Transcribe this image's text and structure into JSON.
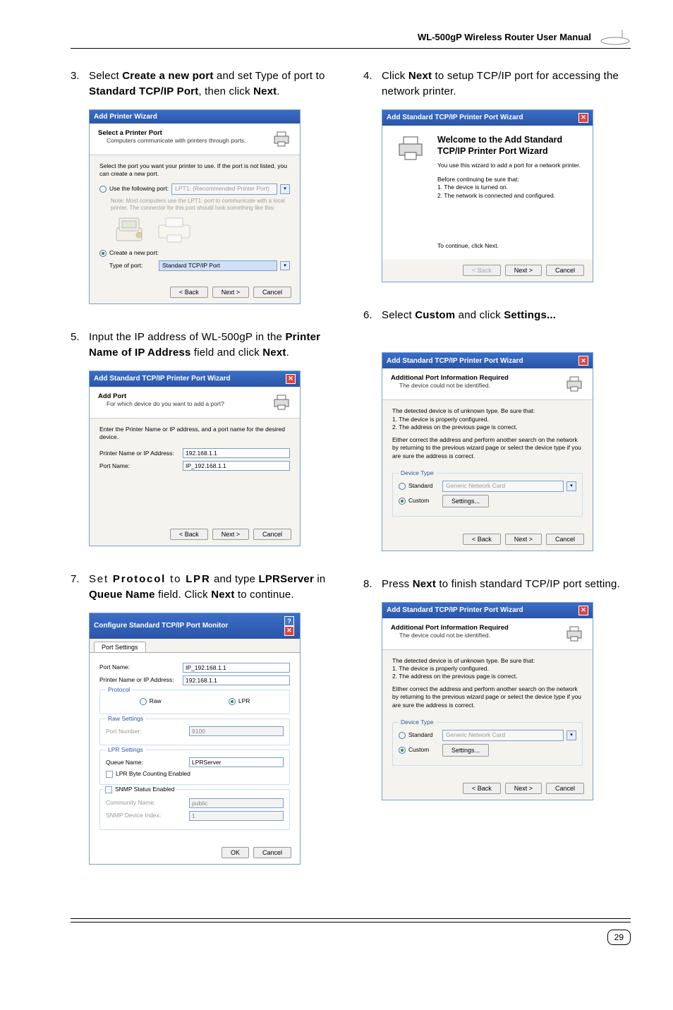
{
  "header": {
    "title": "WL-500gP Wireless Router User Manual"
  },
  "page_number": "29",
  "steps": {
    "s3": {
      "num": "3.",
      "text_pre": "Select ",
      "b1": "Create a new port",
      "text_mid": " and set Type of port to ",
      "b2": "Standard TCP/IP Port",
      "text_mid2": ", then click ",
      "b3": "Next",
      "text_post": "."
    },
    "s4": {
      "num": "4.",
      "text_pre": "Click ",
      "b1": "Next",
      "text_mid": " to setup TCP/IP port for accessing the network printer."
    },
    "s5": {
      "num": "5.",
      "text_pre": "Input the IP address of WL-500gP in the ",
      "b1": "Printer Name of IP Address",
      "text_mid": " field and click ",
      "b2": "Next",
      "text_post": "."
    },
    "s6": {
      "num": "6.",
      "text_pre": "Select ",
      "b1": "Custom",
      "text_mid": " and click ",
      "b2": "Settings...",
      "text_post": ""
    },
    "s7": {
      "num": "7.",
      "text_pre": "Set ",
      "b1": "Protocol",
      "text_mid": " to ",
      "b2": "LPR",
      "text_mid2": " and type ",
      "b3": "LPRServer",
      "text_mid3": " in ",
      "b4": "Queue Name",
      "text_mid4": " field. Click ",
      "b5": "Next",
      "text_post": " to continue."
    },
    "s8": {
      "num": "8.",
      "text_pre": "Press ",
      "b1": "Next",
      "text_mid": " to finish standard TCP/IP port setting."
    }
  },
  "common_btns": {
    "back": "< Back",
    "next": "Next >",
    "cancel": "Cancel",
    "ok": "OK"
  },
  "dlg3": {
    "title": "Add Printer Wizard",
    "head_title": "Select a Printer Port",
    "head_sub": "Computers communicate with printers through ports.",
    "desc": "Select the port you want your printer to use. If the port is not listed, you can create a new port.",
    "opt1": "Use the following port:",
    "opt1_val": "LPT1: (Recommended Printer Port)",
    "note": "Note: Most computers use the LPT1: port to communicate with a local printer. The connector for this port should look something like this:",
    "opt2": "Create a new port:",
    "opt2_label": "Type of port:",
    "opt2_val": "Standard TCP/IP Port"
  },
  "dlg4": {
    "title": "Add Standard TCP/IP Printer Port Wizard",
    "welcome_h": "Welcome to the Add Standard TCP/IP Printer Port Wizard",
    "welcome_p1": "You use this wizard to add a port for a network printer.",
    "welcome_p2": "Before continuing be sure that:",
    "welcome_li1": "1.  The device is turned on.",
    "welcome_li2": "2.  The network is connected and configured.",
    "welcome_cont": "To continue, click Next."
  },
  "dlg5": {
    "title": "Add Standard TCP/IP Printer Port Wizard",
    "head_title": "Add Port",
    "head_sub": "For which device do you want to add a port?",
    "desc": "Enter the Printer Name or IP address, and a port name for the desired device.",
    "lbl1": "Printer Name or IP Address:",
    "val1": "192.168.1.1",
    "lbl2": "Port Name:",
    "val2": "IP_192.168.1.1"
  },
  "dlg6": {
    "title": "Add Standard TCP/IP Printer Port Wizard",
    "head_title": "Additional Port Information Required",
    "head_sub": "The device could not be identified.",
    "p1": "The detected device is of unknown type. Be sure that:",
    "li1": "1. The device is properly configured.",
    "li2": "2. The address on the previous page is correct.",
    "p2": "Either correct the address and perform another search on the network by returning to the previous wizard page or select the device type if you are sure the address is correct.",
    "group": "Device Type",
    "opt_std": "Standard",
    "opt_std_val": "Generic Network Card",
    "opt_custom": "Custom",
    "btn_settings": "Settings..."
  },
  "dlg7": {
    "title": "Configure Standard TCP/IP Port Monitor",
    "tab": "Port Settings",
    "lbl_port": "Port Name:",
    "val_port": "IP_192.168.1.1",
    "lbl_addr": "Printer Name or IP Address:",
    "val_addr": "192.168.1.1",
    "grp_proto": "Protocol",
    "opt_raw": "Raw",
    "opt_lpr": "LPR",
    "grp_raw": "Raw Settings",
    "lbl_rawport": "Port Number:",
    "val_rawport": "9100",
    "grp_lpr": "LPR Settings",
    "lbl_queue": "Queue Name:",
    "val_queue": "LPRServer",
    "chk_lprbyte": "LPR Byte Counting Enabled",
    "chk_snmp": "SNMP Status Enabled",
    "lbl_comm": "Community Name:",
    "val_comm": "public",
    "lbl_snmpidx": "SNMP Device Index:",
    "val_snmpidx": "1"
  }
}
